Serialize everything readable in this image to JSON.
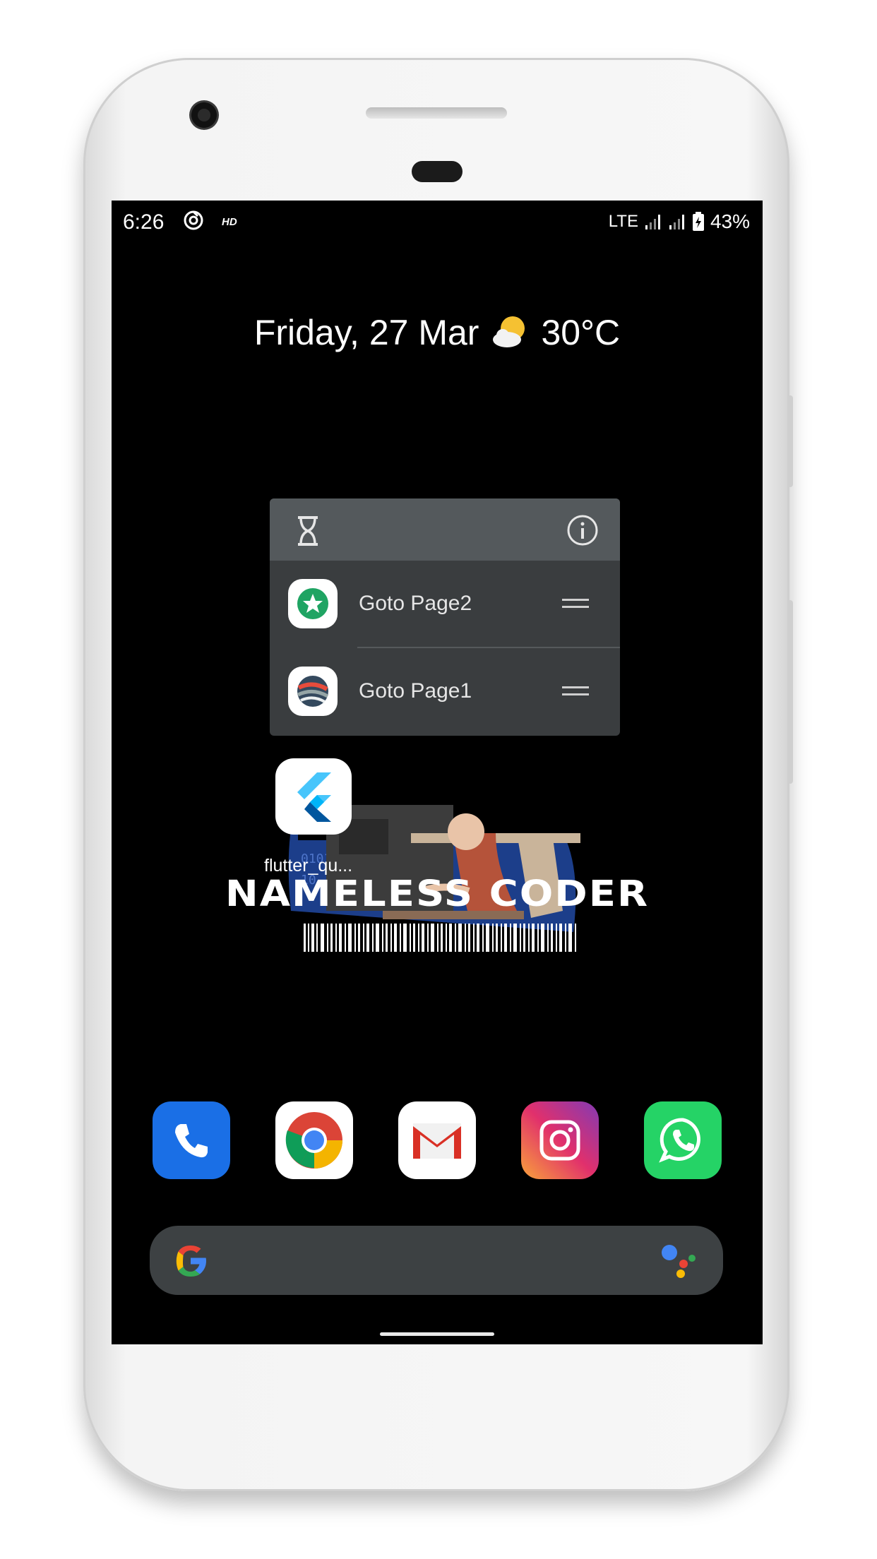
{
  "status_bar": {
    "time": "6:26",
    "hd": "HD",
    "network": "LTE",
    "battery": "43%"
  },
  "home": {
    "date": "Friday, 27 Mar",
    "temperature": "30°C",
    "weather_icon": "partly-cloudy-icon"
  },
  "shortcuts_popup": {
    "header_icon": "hourglass-icon",
    "info_icon": "info-icon",
    "items": [
      {
        "label": "Goto Page2",
        "icon": "star-badge-icon"
      },
      {
        "label": "Goto Page1",
        "icon": "globe-icon"
      }
    ]
  },
  "home_app": {
    "label": "flutter_qu...",
    "icon": "flutter-icon"
  },
  "wallpaper": {
    "brand_text": "NAMELESS CODER"
  },
  "dock": {
    "apps": [
      {
        "name": "Phone",
        "icon": "phone-icon"
      },
      {
        "name": "Chrome",
        "icon": "chrome-icon"
      },
      {
        "name": "Gmail",
        "icon": "gmail-icon"
      },
      {
        "name": "Instagram",
        "icon": "instagram-icon"
      },
      {
        "name": "WhatsApp",
        "icon": "whatsapp-icon"
      }
    ]
  },
  "search_bar": {
    "left_icon": "google-g-icon",
    "right_icon": "assistant-icon"
  },
  "colors": {
    "screen_bg": "#000000",
    "popup_bg": "#3a3d3f",
    "popup_header": "#54595c",
    "search_bar": "#3d4143"
  }
}
